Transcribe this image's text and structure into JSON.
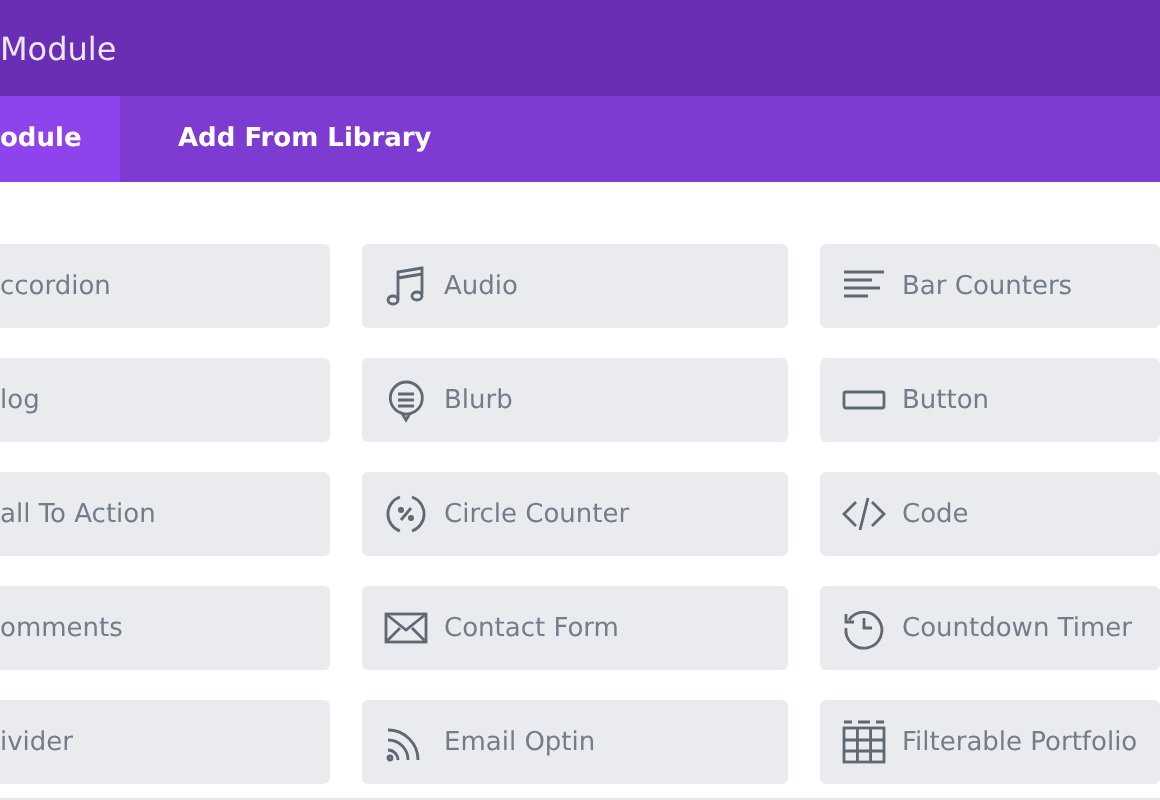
{
  "window": {
    "title": "Module"
  },
  "tabs": [
    {
      "label": "odule",
      "selected": true
    },
    {
      "label": "Add From Library",
      "selected": false
    }
  ],
  "modules": [
    {
      "label": "ccordion"
    },
    {
      "label": "Audio",
      "kind": "music"
    },
    {
      "label": "Bar Counters",
      "kind": "bars"
    },
    {
      "label": "log"
    },
    {
      "label": "Blurb",
      "kind": "bubble"
    },
    {
      "label": "Button",
      "kind": "button"
    },
    {
      "label": "all To Action"
    },
    {
      "label": "Circle Counter",
      "kind": "circle"
    },
    {
      "label": "Code",
      "kind": "code"
    },
    {
      "label": "omments"
    },
    {
      "label": "Contact Form",
      "kind": "mail"
    },
    {
      "label": "Countdown Timer",
      "kind": "timer"
    },
    {
      "label": "ivider"
    },
    {
      "label": "Email Optin",
      "kind": "rss"
    },
    {
      "label": "Filterable Portfolio",
      "kind": "grid"
    }
  ]
}
